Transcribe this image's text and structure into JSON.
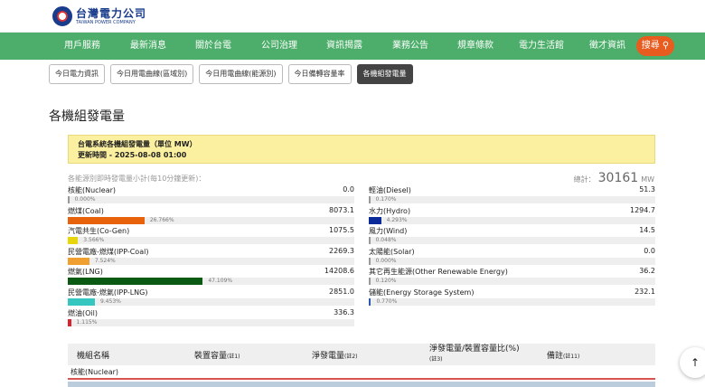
{
  "brand": {
    "name_zh": "台灣電力公司",
    "name_en": "TAIWAN POWER COMPANY"
  },
  "nav": [
    "用戶服務",
    "最新消息",
    "關於台電",
    "公司治理",
    "資訊揭露",
    "業務公告",
    "規章條款",
    "電力生活館",
    "徵才資訊"
  ],
  "search_label": "搜尋",
  "subtabs": [
    "今日電力資訊",
    "今日用電曲線(區域別)",
    "今日用電曲線(能源別)",
    "今日備轉容量率",
    "各機組發電量"
  ],
  "active_subtab": "各機組發電量",
  "page_title": "各機組發電量",
  "notice": {
    "line1": "台電系統各機組發電量（單位 MW）",
    "line2": "更新時間 - 2025-08-08 01:00"
  },
  "summary_label": "各能源別即時發電量小計(每10分鐘更新)：",
  "total": {
    "prefix": "總計：",
    "value": "30161",
    "unit": "MW"
  },
  "colors": {
    "nav": "#4cae6a",
    "accent": "#e85d1f"
  },
  "energy_left": [
    {
      "name": "核能(Nuclear)",
      "value": "0.0",
      "pct": "0.000%",
      "ratio": 0.0,
      "color": "#999999"
    },
    {
      "name": "燃煤(Coal)",
      "value": "8073.1",
      "pct": "26.766%",
      "ratio": 0.26766,
      "color": "#e8620c"
    },
    {
      "name": "汽電共生(Co-Gen)",
      "value": "1075.5",
      "pct": "3.566%",
      "ratio": 0.03566,
      "color": "#e8d60c"
    },
    {
      "name": "民營電廠-燃煤(IPP-Coal)",
      "value": "2269.3",
      "pct": "7.524%",
      "ratio": 0.07524,
      "color": "#f0a030"
    },
    {
      "name": "燃氣(LNG)",
      "value": "14208.6",
      "pct": "47.109%",
      "ratio": 0.47109,
      "color": "#0a5a14"
    },
    {
      "name": "民營電廠-燃氣(IPP-LNG)",
      "value": "2851.0",
      "pct": "9.453%",
      "ratio": 0.09453,
      "color": "#35c6c0"
    },
    {
      "name": "燃油(Oil)",
      "value": "336.3",
      "pct": "1.115%",
      "ratio": 0.01115,
      "color": "#d9232e"
    }
  ],
  "energy_right": [
    {
      "name": "輕油(Diesel)",
      "value": "51.3",
      "pct": "0.170%",
      "ratio": 0.0017,
      "color": "#999999"
    },
    {
      "name": "水力(Hydro)",
      "value": "1294.7",
      "pct": "4.293%",
      "ratio": 0.04293,
      "color": "#0a2a9a"
    },
    {
      "name": "風力(Wind)",
      "value": "14.5",
      "pct": "0.048%",
      "ratio": 0.00048,
      "color": "#999999"
    },
    {
      "name": "太陽能(Solar)",
      "value": "0.0",
      "pct": "0.000%",
      "ratio": 0.0,
      "color": "#999999"
    },
    {
      "name": "其它再生能源(Other Renewable Energy)",
      "value": "36.2",
      "pct": "0.120%",
      "ratio": 0.0012,
      "color": "#999999"
    },
    {
      "name": "儲能(Energy Storage System)",
      "value": "232.1",
      "pct": "0.770%",
      "ratio": 0.0077,
      "color": "#2a5ab0"
    }
  ],
  "table": {
    "headers": [
      {
        "label": "機組名稱",
        "note": ""
      },
      {
        "label": "裝置容量",
        "note": "(註1)"
      },
      {
        "label": "淨發電量",
        "note": "(註2)"
      },
      {
        "label": "淨發電量/裝置容量比(%)",
        "note": "(註3)"
      },
      {
        "label": "備註",
        "note": "(註11)"
      }
    ],
    "section": "核能(Nuclear)"
  }
}
